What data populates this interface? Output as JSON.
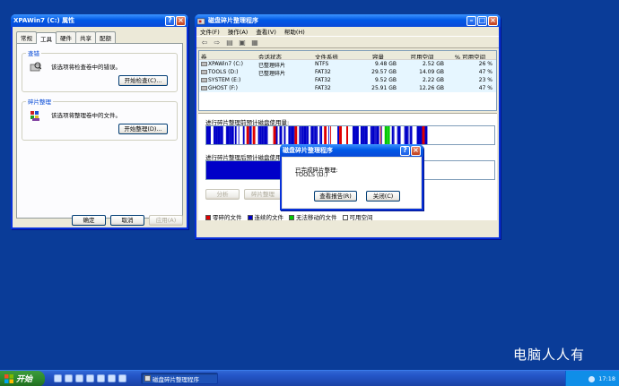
{
  "props_window": {
    "title": "XPAWin7 (C:) 属性",
    "tabs": [
      "常规",
      "工具",
      "硬件",
      "共享",
      "配额"
    ],
    "selected_tab": 1,
    "check_group": {
      "title": "查错",
      "text": "该选项将检查卷中的错误。",
      "button": "开始检查(C)..."
    },
    "defrag_group": {
      "title": "碎片整理",
      "text": "该选项将整理卷中的文件。",
      "button": "开始整理(D)..."
    },
    "buttons": {
      "ok": "确定",
      "cancel": "取消",
      "apply": "应用(A)"
    }
  },
  "defrag_window": {
    "title": "磁盘碎片整理程序",
    "menu": [
      "文件(F)",
      "操作(A)",
      "查看(V)",
      "帮助(H)"
    ],
    "columns": [
      "卷",
      "会话状态",
      "文件系统",
      "容量",
      "可用空间",
      "% 可用空间"
    ],
    "volumes": [
      {
        "name": "XPAWin7 (C:)",
        "status": "已整理碎片",
        "fs": "NTFS",
        "capacity": "9.48 GB",
        "free": "2.52 GB",
        "pct": "26 %"
      },
      {
        "name": "TOOLS (D:)",
        "status": "已整理碎片",
        "fs": "FAT32",
        "capacity": "29.57 GB",
        "free": "14.09 GB",
        "pct": "47 %"
      },
      {
        "name": "SYSTEM (E:)",
        "status": "",
        "fs": "FAT32",
        "capacity": "9.52 GB",
        "free": "2.22 GB",
        "pct": "23 %"
      },
      {
        "name": "GHOST (F:)",
        "status": "",
        "fs": "FAT32",
        "capacity": "25.91 GB",
        "free": "12.26 GB",
        "pct": "47 %"
      }
    ],
    "before_label": "进行碎片整理前预计磁盘使用量:",
    "after_label": "进行碎片整理后预计磁盘使用量:",
    "buttons": {
      "analyze": "分析",
      "defrag": "碎片整理"
    },
    "legend": [
      {
        "label": "零碎的文件",
        "color": "#e00000"
      },
      {
        "label": "连续的文件",
        "color": "#0000c8"
      },
      {
        "label": "无法移动的文件",
        "color": "#00c800"
      },
      {
        "label": "可用空间",
        "color": "#ffffff"
      }
    ]
  },
  "dialog": {
    "title": "磁盘碎片整理程序",
    "message": "已完成碎片整理:",
    "volume": "TOOLS (D:)",
    "view_report": "查看报告(R)",
    "close": "关闭(C)"
  },
  "taskbar": {
    "start": "开始",
    "task": "磁盘碎片整理程序",
    "clock": "17:18"
  },
  "watermark": "电脑人人有",
  "colors": {
    "desktop": "#0a3c98",
    "titlebar": "#0058e6",
    "fragmented": "#e00000",
    "contiguous": "#0000c8",
    "unmovable": "#00c800"
  }
}
